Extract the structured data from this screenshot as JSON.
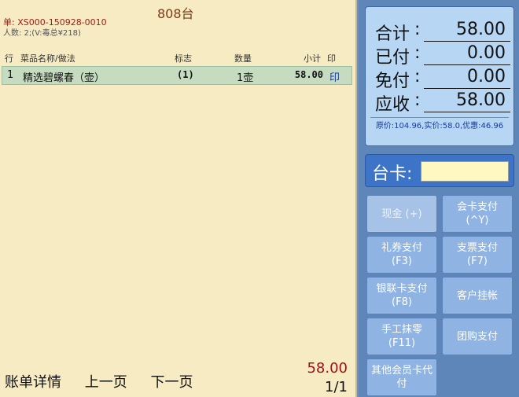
{
  "order": {
    "table_name": "808台",
    "bill_label": "单:",
    "bill_no": "XS000-150928-0010",
    "people": "人数: 2;(V:毒总¥218)"
  },
  "columns": {
    "idx": "行",
    "name": "菜品名称/做法",
    "flag": "标志",
    "qty": "数量",
    "subtotal": "小计",
    "print": "印"
  },
  "items": [
    {
      "idx": "1",
      "name": "精选碧螺春（壶）",
      "flag": "(1)",
      "qty": "1壶",
      "subtotal": "58.00",
      "print": "印"
    }
  ],
  "bottom": {
    "details": "账单详情",
    "prev": "上一页",
    "next": "下一页",
    "total": "58.00",
    "page": "1/1"
  },
  "summary": {
    "total_label": "合计",
    "total": "58.00",
    "paid_label": "已付",
    "paid": "0.00",
    "free_label": "免付",
    "free": "0.00",
    "due_label": "应收",
    "due": "58.00",
    "colon": ":",
    "note": "原价:104.96,实价:58.0,优惠:46.96"
  },
  "card": {
    "label": "台卡:",
    "value": ""
  },
  "buttons": {
    "cash": "现金 (+)",
    "member": "会卡支付\n(^Y)",
    "coupon": "礼券支付\n(F3)",
    "cheque": "支票支付\n(F7)",
    "unionpay": "银联卡支付\n(F8)",
    "credit": "客户挂帐",
    "round": "手工抹零\n(F11)",
    "groupbuy": "团购支付",
    "other_member": "其他会员卡代\n付"
  }
}
